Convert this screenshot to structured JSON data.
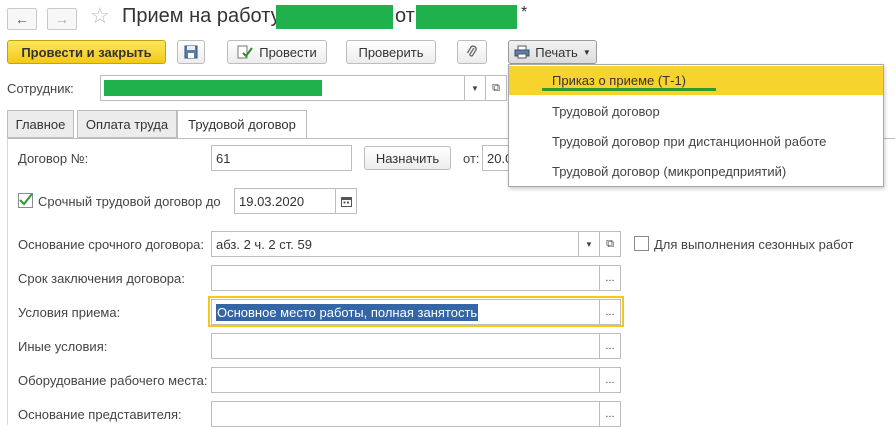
{
  "window": {
    "title_prefix": "Прием на работу",
    "title_mid": "от",
    "title_mark": "*"
  },
  "nav": {
    "back_icon": "arrow-left-icon",
    "forward_icon": "arrow-right-icon",
    "favorite_icon": "star-icon"
  },
  "toolbar": {
    "post_close": "Провести и закрыть",
    "post": "Провести",
    "check": "Проверить",
    "print": "Печать"
  },
  "employee": {
    "label": "Сотрудник:"
  },
  "tabs": [
    {
      "label": "Главное"
    },
    {
      "label": "Оплата труда"
    },
    {
      "label": "Трудовой договор"
    }
  ],
  "print_menu": {
    "items": [
      {
        "label": "Приказ о приеме (Т-1)",
        "selected": true
      },
      {
        "label": "Трудовой договор"
      },
      {
        "label": "Трудовой договор при дистанционной работе"
      },
      {
        "label": "Трудовой договор (микропредприятий)"
      }
    ]
  },
  "contract": {
    "number_label": "Договор №:",
    "number_value": "61",
    "assign_btn": "Назначить",
    "from_label": "от:",
    "from_value": "20.0",
    "fixed_term_label": "Срочный трудовой договор до",
    "fixed_term_checked": true,
    "fixed_term_date": "19.03.2020",
    "basis_label": "Основание срочного договора:",
    "basis_value": "абз. 2 ч. 2 ст. 59",
    "seasonal_label": "Для выполнения сезонных работ",
    "term_label": "Срок заключения договора:",
    "conditions_label": "Условия приема:",
    "conditions_value": "Основное место работы, полная занятость",
    "other_label": "Иные условия:",
    "equipment_label": "Оборудование рабочего места:",
    "representative_label": "Основание представителя:",
    "ellipsis": "..."
  },
  "colors": {
    "accent_yellow": "#f8d22d",
    "redaction_green": "#21b14c",
    "selection_blue": "#3465a4",
    "check_green": "#3a9a3a"
  }
}
